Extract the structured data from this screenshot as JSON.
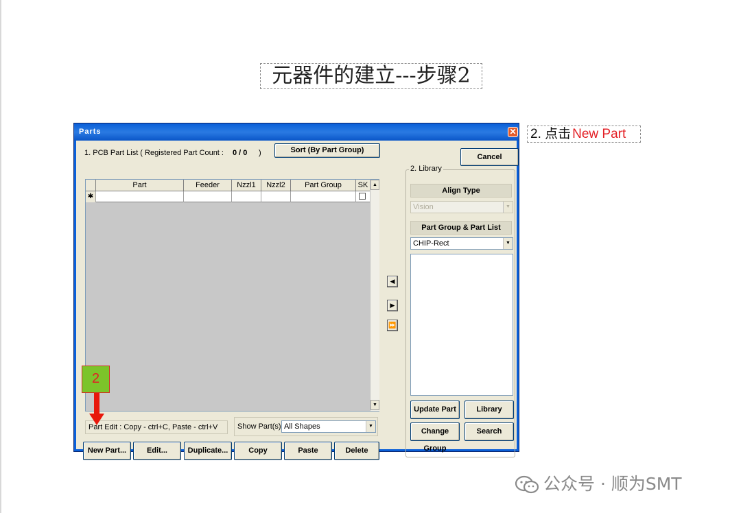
{
  "slide": {
    "title": "元器件的建立---步骤2",
    "note_prefix": "2. 点击",
    "note_highlight": "New  Part"
  },
  "dialog": {
    "title": "Parts",
    "close_glyph": "✕",
    "part_list_label": "1. PCB Part List  ( Registered Part Count :",
    "part_count": "0 / 0",
    "part_count_close": ")",
    "sort_button": "Sort (By Part Group)",
    "cancel_button": "Cancel",
    "columns": [
      "Part",
      "Feeder",
      "Nzzl1",
      "Nzzl2",
      "Part Group",
      "SK"
    ],
    "new_row_marker": "✱",
    "edit_hint": "Part Edit : Copy - ctrl+C,  Paste - ctrl+V",
    "show_parts_label": "Show Part(s)",
    "show_parts_value": "All Shapes",
    "bottom_buttons": [
      "New Part...",
      "Edit...",
      "Duplicate...",
      "Copy",
      "Paste",
      "Delete"
    ],
    "arrow_buttons": [
      "◀",
      "▶",
      "⏩"
    ],
    "library": {
      "caption": "2. Library",
      "align_type_header": "Align Type",
      "align_type_value": "Vision",
      "part_group_header": "Part Group & Part List",
      "part_group_value": "CHIP-Rect",
      "buttons": [
        "Update Part",
        "Library Delete",
        "Change Group",
        "Search"
      ]
    }
  },
  "annotation": {
    "step_number": "2"
  },
  "watermark": {
    "text": "公众号 · 顺为SMT",
    "logo_icon": "wechat-icon"
  },
  "colors": {
    "highlight": "#e31e24",
    "titlebar": "#0a5fd8",
    "annotation_box": "#7cc42a"
  }
}
